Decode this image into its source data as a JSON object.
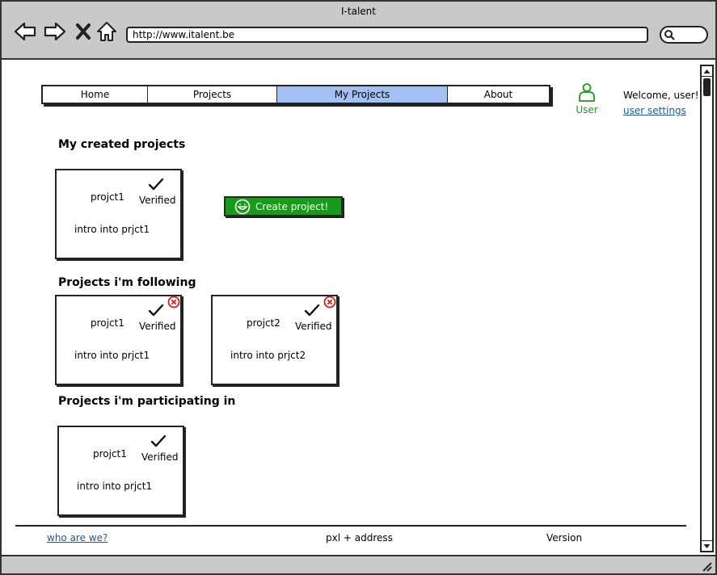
{
  "window": {
    "title": "I-talent"
  },
  "browser": {
    "url": "http://www.italent.be",
    "icons": [
      "back-arrow-icon",
      "forward-arrow-icon",
      "stop-icon",
      "home-icon",
      "search-icon"
    ]
  },
  "nav": {
    "tabs": [
      {
        "label": "Home",
        "active": false
      },
      {
        "label": "Projects",
        "active": false
      },
      {
        "label": "My Projects",
        "active": true
      },
      {
        "label": "About",
        "active": false
      }
    ],
    "active_color": "#a3c0f5"
  },
  "user": {
    "icon": "user-icon",
    "label": "User",
    "label_color": "#1f9a1f",
    "welcome": "Welcome, user!",
    "settings_link": "user settings"
  },
  "sections": {
    "created": {
      "title": "My created projects",
      "projects": [
        {
          "name": "projct1",
          "status": "Verified",
          "intro": "intro into prjct1"
        }
      ],
      "create_button": {
        "label": "Create project!",
        "icon": "smiley-icon",
        "color": "#1a9a1a"
      }
    },
    "following": {
      "title": "Projects i'm following",
      "projects": [
        {
          "name": "projct1",
          "status": "Verified",
          "intro": "intro into prjct1",
          "remove_icon": "remove-circle-icon"
        },
        {
          "name": "projct2",
          "status": "Verified",
          "intro": "intro into prjct2",
          "remove_icon": "remove-circle-icon"
        }
      ]
    },
    "participating": {
      "title": "Projects i'm participating in",
      "projects": [
        {
          "name": "projct1",
          "status": "Verified",
          "intro": "intro into prjct1"
        }
      ]
    }
  },
  "footer": {
    "link": "who are we?",
    "address": "pxl + address",
    "version": "Version"
  }
}
